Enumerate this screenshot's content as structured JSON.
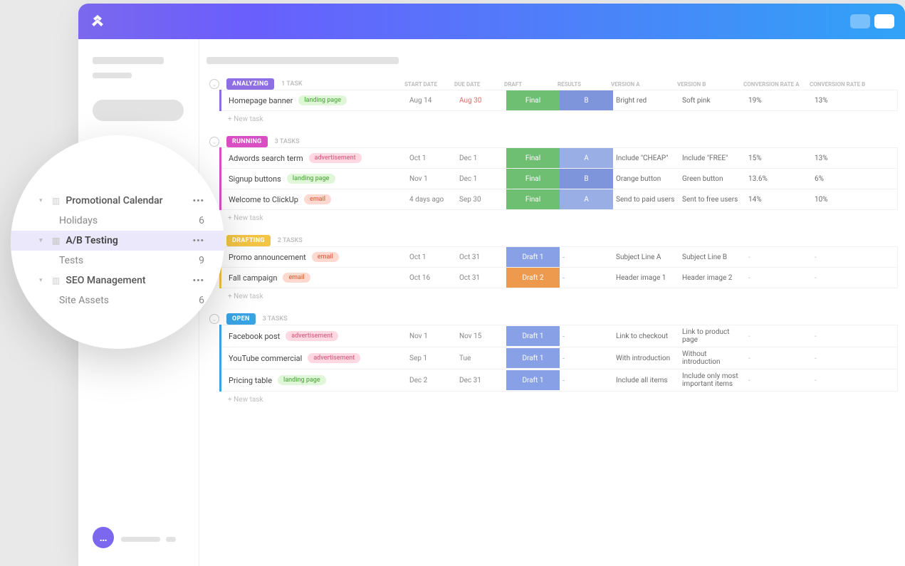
{
  "colors": {
    "analyzing": "#8e6fe3",
    "running": "#d94ec2",
    "drafting": "#f4c544",
    "open": "#3aa3e3",
    "final": "#6fbf73",
    "draft1": "#88a0e5",
    "draft2": "#ed9a4f",
    "resA": "#9aaee6",
    "resB": "#7f95db"
  },
  "new_task_label": "+ New task",
  "columns": [
    "START DATE",
    "DUE DATE",
    "DRAFT",
    "RESULTS",
    "VERSION A",
    "VERSION B",
    "CONVERSION RATE A",
    "CONVERSION RATE B"
  ],
  "groups": [
    {
      "id": "analyzing",
      "label": "ANALYZING",
      "count_label": "1 TASK",
      "accent": "#8e6fe3",
      "tasks": [
        {
          "name": "Homepage banner",
          "tag": "landing page",
          "tag_class": "tag-landing",
          "start": "Aug 14",
          "due": "Aug 30",
          "due_over": true,
          "draft": "Final",
          "draft_color": "#6fbf73",
          "result": "B",
          "result_color": "#7f95db",
          "va": "Bright red",
          "vb": "Soft pink",
          "cra": "19%",
          "crb": "13%"
        }
      ]
    },
    {
      "id": "running",
      "label": "RUNNING",
      "count_label": "3 TASKS",
      "accent": "#d94ec2",
      "tasks": [
        {
          "name": "Adwords search term",
          "tag": "advertisement",
          "tag_class": "tag-ad",
          "start": "Oct 1",
          "due": "Dec 1",
          "draft": "Final",
          "draft_color": "#6fbf73",
          "result": "A",
          "result_color": "#9aaee6",
          "va": "Include \"CHEAP\"",
          "vb": "Include \"FREE\"",
          "cra": "15%",
          "crb": "13%"
        },
        {
          "name": "Signup buttons",
          "tag": "landing page",
          "tag_class": "tag-landing",
          "start": "Nov 1",
          "due": "Dec 1",
          "draft": "Final",
          "draft_color": "#6fbf73",
          "result": "B",
          "result_color": "#7f95db",
          "va": "Orange button",
          "vb": "Green button",
          "cra": "13.6%",
          "crb": "6%"
        },
        {
          "name": "Welcome to ClickUp",
          "tag": "email",
          "tag_class": "tag-email",
          "start": "4 days ago",
          "due": "Sep 30",
          "draft": "Final",
          "draft_color": "#6fbf73",
          "result": "A",
          "result_color": "#9aaee6",
          "va": "Send to paid users",
          "vb": "Sent to free users",
          "cra": "14%",
          "crb": "10%"
        }
      ]
    },
    {
      "id": "drafting",
      "label": "DRAFTING",
      "count_label": "2 TASKS",
      "accent": "#f4c544",
      "tasks": [
        {
          "name": "Promo announcement",
          "tag": "email",
          "tag_class": "tag-email",
          "start": "Oct 1",
          "due": "Oct 31",
          "draft": "Draft 1",
          "draft_color": "#88a0e5",
          "result": "-",
          "va": "Subject Line A",
          "vb": "Subject Line B",
          "cra": "-",
          "crb": "-"
        },
        {
          "name": "Fall campaign",
          "tag": "email",
          "tag_class": "tag-email",
          "start": "Oct 16",
          "due": "Oct 31",
          "draft": "Draft 2",
          "draft_color": "#ed9a4f",
          "result": "-",
          "va": "Header image 1",
          "vb": "Header image 2",
          "cra": "-",
          "crb": "-"
        }
      ]
    },
    {
      "id": "open",
      "label": "OPEN",
      "count_label": "3 TASKS",
      "accent": "#3aa3e3",
      "tasks": [
        {
          "name": "Facebook post",
          "tag": "advertisement",
          "tag_class": "tag-ad",
          "start": "Nov 1",
          "due": "Nov 15",
          "draft": "Draft 1",
          "draft_color": "#88a0e5",
          "result": "-",
          "va": "Link to checkout",
          "vb": "Link to product page",
          "cra": "-",
          "crb": "-"
        },
        {
          "name": "YouTube commercial",
          "tag": "advertisement",
          "tag_class": "tag-ad",
          "start": "Sep 1",
          "due": "Tue",
          "draft": "Draft 1",
          "draft_color": "#88a0e5",
          "result": "-",
          "va": "With introduction",
          "vb": "Without introduction",
          "cra": "-",
          "crb": "-"
        },
        {
          "name": "Pricing table",
          "tag": "landing page",
          "tag_class": "tag-landing",
          "start": "Dec 2",
          "due": "Dec 31",
          "draft": "Draft 1",
          "draft_color": "#88a0e5",
          "result": "-",
          "va": "Include all items",
          "vb": "Include only most important items",
          "cra": "-",
          "crb": "-"
        }
      ]
    }
  ],
  "zoom_sidebar": {
    "items": [
      {
        "type": "folder",
        "label": "Promotional Calendar",
        "dots": true
      },
      {
        "type": "list",
        "label": "Holidays",
        "count": "6"
      },
      {
        "type": "folder",
        "label": "A/B Testing",
        "dots": true,
        "selected": true
      },
      {
        "type": "list",
        "label": "Tests",
        "count": "9"
      },
      {
        "type": "folder",
        "label": "SEO Management",
        "dots": true
      },
      {
        "type": "list",
        "label": "Site Assets",
        "count": "6"
      }
    ]
  },
  "chat_icon": "…"
}
